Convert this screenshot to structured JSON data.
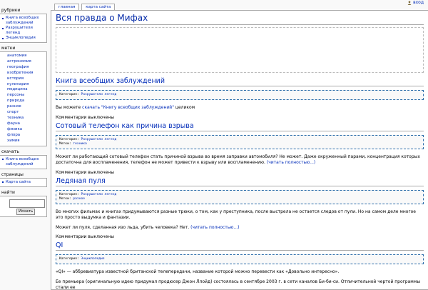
{
  "login": {
    "label": "вход"
  },
  "tabs": [
    "главная",
    "карта сайта"
  ],
  "sidebar": {
    "rubrics": {
      "title": "рубрики",
      "items": [
        "Книга всеобщих заблуждений",
        "Разрушители легенд",
        "Энциклопедия"
      ]
    },
    "tags": {
      "title": "метки",
      "items": [
        "анатомия",
        "астрономия",
        "география",
        "изобретения",
        "история",
        "кулинария",
        "медицина",
        "персоны",
        "природа",
        "разное",
        "спорт",
        "техника",
        "фауна",
        "физика",
        "флора",
        "химия"
      ]
    },
    "download": {
      "title": "скачать",
      "items": [
        "Книга всеобщих заблуждений"
      ]
    },
    "pages": {
      "title": "страницы",
      "items": [
        "Карта сайта"
      ]
    },
    "search": {
      "title": "найти",
      "button": "Искать"
    }
  },
  "page": {
    "title": "Вся правда о Мифах"
  },
  "posts": [
    {
      "title": "Книга всеобщих заблуждений",
      "category_label": "Категория:",
      "category": "Разрушители легенд",
      "text_before": "Вы можете ",
      "link": "скачать \"Книгу всеобщих заблуждений\"",
      "text_after": " целиком",
      "comments": "Комментарии выключены"
    },
    {
      "title": "Сотовый телефон как причина взрыва",
      "category_label": "Категория:",
      "category": "Разрушители легенд",
      "tags_label": "Метки:",
      "tags": "техника",
      "text": "Может ли работающий сотовый телефон стать причиной взрыва во время заправки автомобиля? Не может. Даже окруженный парами, концентрация которых достаточна для воспламенения, телефон не может привести к взрыву или воспламенению.",
      "more": "(читать полностью...)",
      "comments": "Комментарии выключены"
    },
    {
      "title": "Ледяная пуля",
      "category_label": "Категория:",
      "category": "Разрушители легенд",
      "tags_label": "Метки:",
      "tags": "разное",
      "text1": "Во многих фильмах и книгах придумываются разные трюки,  о том, как у преступника, после выстрела не остается следов от пули.  Но на самом деле многое это просто выдумка и фантазии.",
      "text2": "Может ли пуля, сделанная изо льда, убить человека? Нет.",
      "more": "(читать полностью...)",
      "comments": "Комментарии выключены"
    },
    {
      "title": "QI",
      "category_label": "Категория:",
      "category": "Энциклопедия",
      "text1": "«QI» — аббревиатура известной британской телепередачи, название которой можно перевести как «Довольно интересно».",
      "text2": "Ее премьера (оригинальную идею придумал продюсер Джон Ллойд) состоялась в сентябре 2003 г. в сети каналов Би-би-си. Отличительной чертой программы стали ее"
    }
  ]
}
